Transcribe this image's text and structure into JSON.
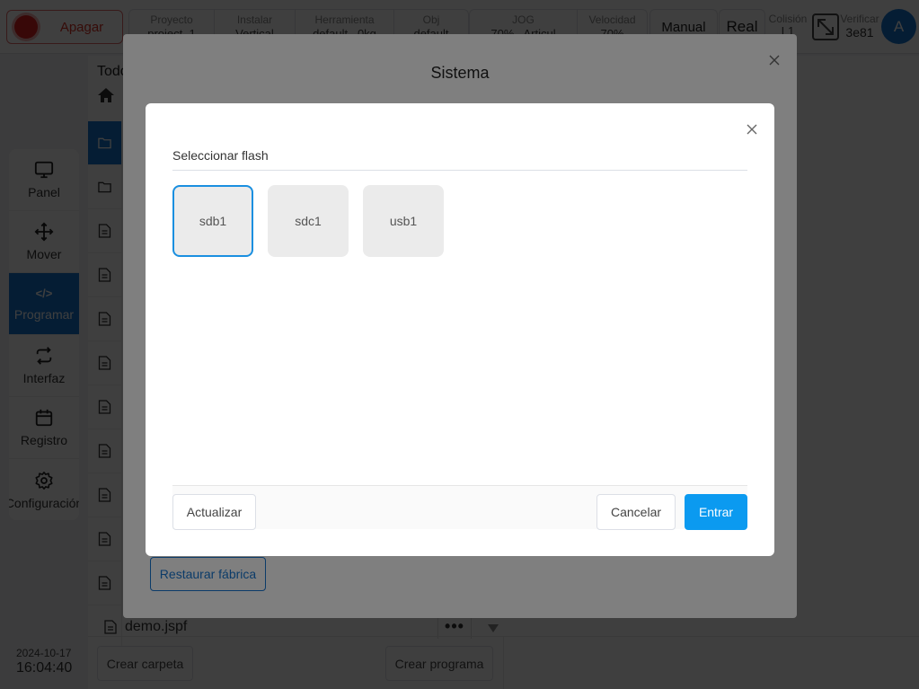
{
  "topbar": {
    "power_label": "Apagar",
    "group1": [
      {
        "label": "Proyecto",
        "value": "project_1"
      },
      {
        "label": "Instalar",
        "value": "Vertical"
      },
      {
        "label": "Herramienta",
        "value": "default   0kg"
      },
      {
        "label": "Obj",
        "value": "default"
      }
    ],
    "group2": [
      {
        "label": "JOG",
        "value": "70%   Articul"
      },
      {
        "label": "Velocidad",
        "value": "70%"
      }
    ],
    "mode_manual": "Manual",
    "mode_real": "Real",
    "colision_label": "Colisión",
    "colision_value": "L1",
    "verificar_label": "Verificar",
    "verificar_value": "3e81",
    "avatar_letter": "A"
  },
  "sidenav": {
    "items": [
      {
        "label": "Panel",
        "icon": "monitor-icon"
      },
      {
        "label": "Mover",
        "icon": "move-arrows-icon"
      },
      {
        "label": "Programar",
        "icon": "code-icon",
        "code": "</>"
      },
      {
        "label": "Interfaz",
        "icon": "swap-arrows-icon"
      },
      {
        "label": "Registro",
        "icon": "calendar-icon"
      },
      {
        "label": "Configuración",
        "icon": "gear-icon"
      }
    ],
    "active_index": 2
  },
  "datetime": {
    "date": "2024-10-17",
    "time": "16:04:40"
  },
  "filepanel": {
    "title": "Todo",
    "demo_file": "demo.jspf",
    "more_label": "•••",
    "create_folder": "Crear carpeta",
    "create_program": "Crear programa"
  },
  "sistema": {
    "title": "Sistema",
    "restore_label": "Restaurar fábrica"
  },
  "flash": {
    "section_label": "Seleccionar flash",
    "drives": [
      "sdb1",
      "sdc1",
      "usb1"
    ],
    "selected_drive": "sdb1",
    "refresh_label": "Actualizar",
    "cancel_label": "Cancelar",
    "enter_label": "Entrar"
  },
  "colors": {
    "accent": "#1677d2",
    "primary_button": "#0b9af0",
    "danger": "#d93025"
  }
}
